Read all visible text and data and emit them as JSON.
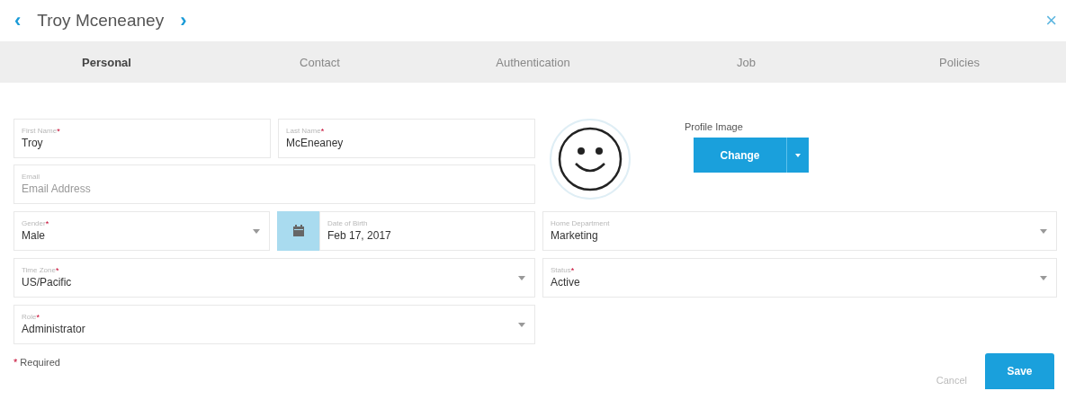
{
  "header": {
    "prev": "‹",
    "title": "Troy Mceneaney",
    "next": "›",
    "close": "×"
  },
  "tabs": [
    {
      "label": "Personal",
      "selected": true
    },
    {
      "label": "Contact",
      "selected": false
    },
    {
      "label": "Authentication",
      "selected": false
    },
    {
      "label": "Job",
      "selected": false
    },
    {
      "label": "Policies",
      "selected": false
    }
  ],
  "fields": [
    {
      "kind": "text",
      "label": "First Name",
      "required": true,
      "value": "Troy"
    },
    {
      "kind": "text",
      "label": "Last Name",
      "required": true,
      "value": "McEneaney"
    },
    {
      "kind": "text",
      "label": "Email",
      "required": false,
      "placeholder": "Email Address"
    },
    {
      "kind": "select",
      "label": "Gender",
      "required": true,
      "value": "Male"
    },
    {
      "kind": "date",
      "label": "Date of Birth",
      "required": false,
      "value": "Feb 17, 2017"
    },
    {
      "kind": "select",
      "label": "Home Department",
      "required": false,
      "value": "Marketing"
    },
    {
      "kind": "select",
      "label": "Time Zone",
      "required": true,
      "value": "US/Pacific"
    },
    {
      "kind": "select",
      "label": "Status",
      "required": true,
      "value": "Active"
    },
    {
      "kind": "select",
      "label": "Role",
      "required": true,
      "value": "Administrator"
    }
  ],
  "profile_image": {
    "label": "Profile Image",
    "button": "Change"
  },
  "required_note": {
    "mark": "*",
    "text": "Required"
  },
  "buttons": {
    "cancel": "Cancel",
    "save": "Save"
  }
}
